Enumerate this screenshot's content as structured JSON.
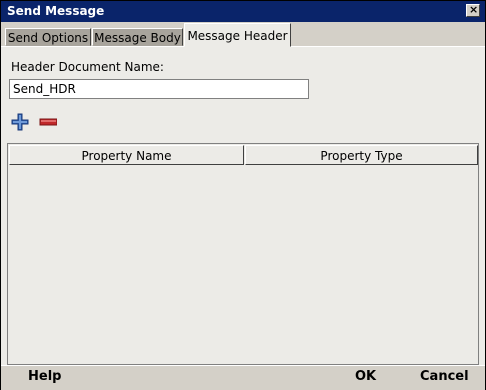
{
  "window": {
    "title": "Send Message"
  },
  "tabs": [
    {
      "label": "Send Options"
    },
    {
      "label": "Message Body"
    },
    {
      "label": "Message Header"
    }
  ],
  "form": {
    "header_label": "Header Document Name:",
    "header_value": "Send_HDR"
  },
  "toolbar": {
    "add_icon": "plus-icon",
    "remove_icon": "minus-icon"
  },
  "table": {
    "columns": [
      "Property Name",
      "Property Type"
    ],
    "rows": []
  },
  "footer": {
    "help_label": "Help",
    "ok_label": "OK",
    "cancel_label": "Cancel"
  },
  "colors": {
    "titlebar": "#0a246a",
    "panel": "#ecebe7",
    "chrome": "#d4d0c8",
    "add_icon": "#2f5fae",
    "remove_icon": "#c0282a"
  }
}
